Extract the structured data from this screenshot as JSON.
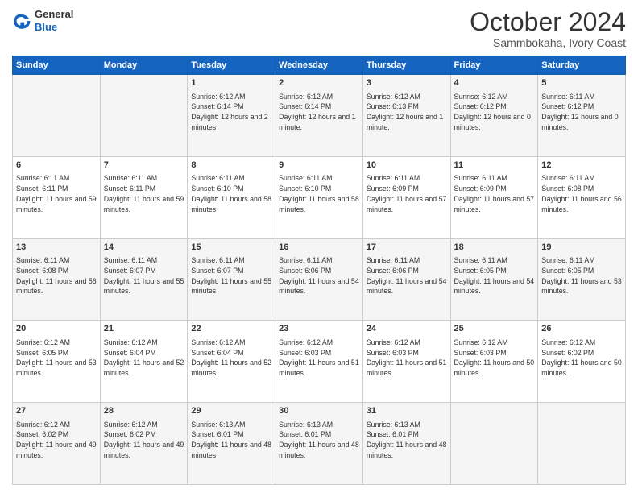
{
  "logo": {
    "general": "General",
    "blue": "Blue"
  },
  "header": {
    "month": "October 2024",
    "location": "Sammbokaha, Ivory Coast"
  },
  "weekdays": [
    "Sunday",
    "Monday",
    "Tuesday",
    "Wednesday",
    "Thursday",
    "Friday",
    "Saturday"
  ],
  "weeks": [
    [
      {
        "day": null
      },
      {
        "day": null
      },
      {
        "day": "1",
        "sunrise": "Sunrise: 6:12 AM",
        "sunset": "Sunset: 6:14 PM",
        "daylight": "Daylight: 12 hours and 2 minutes."
      },
      {
        "day": "2",
        "sunrise": "Sunrise: 6:12 AM",
        "sunset": "Sunset: 6:14 PM",
        "daylight": "Daylight: 12 hours and 1 minute."
      },
      {
        "day": "3",
        "sunrise": "Sunrise: 6:12 AM",
        "sunset": "Sunset: 6:13 PM",
        "daylight": "Daylight: 12 hours and 1 minute."
      },
      {
        "day": "4",
        "sunrise": "Sunrise: 6:12 AM",
        "sunset": "Sunset: 6:12 PM",
        "daylight": "Daylight: 12 hours and 0 minutes."
      },
      {
        "day": "5",
        "sunrise": "Sunrise: 6:11 AM",
        "sunset": "Sunset: 6:12 PM",
        "daylight": "Daylight: 12 hours and 0 minutes."
      }
    ],
    [
      {
        "day": "6",
        "sunrise": "Sunrise: 6:11 AM",
        "sunset": "Sunset: 6:11 PM",
        "daylight": "Daylight: 11 hours and 59 minutes."
      },
      {
        "day": "7",
        "sunrise": "Sunrise: 6:11 AM",
        "sunset": "Sunset: 6:11 PM",
        "daylight": "Daylight: 11 hours and 59 minutes."
      },
      {
        "day": "8",
        "sunrise": "Sunrise: 6:11 AM",
        "sunset": "Sunset: 6:10 PM",
        "daylight": "Daylight: 11 hours and 58 minutes."
      },
      {
        "day": "9",
        "sunrise": "Sunrise: 6:11 AM",
        "sunset": "Sunset: 6:10 PM",
        "daylight": "Daylight: 11 hours and 58 minutes."
      },
      {
        "day": "10",
        "sunrise": "Sunrise: 6:11 AM",
        "sunset": "Sunset: 6:09 PM",
        "daylight": "Daylight: 11 hours and 57 minutes."
      },
      {
        "day": "11",
        "sunrise": "Sunrise: 6:11 AM",
        "sunset": "Sunset: 6:09 PM",
        "daylight": "Daylight: 11 hours and 57 minutes."
      },
      {
        "day": "12",
        "sunrise": "Sunrise: 6:11 AM",
        "sunset": "Sunset: 6:08 PM",
        "daylight": "Daylight: 11 hours and 56 minutes."
      }
    ],
    [
      {
        "day": "13",
        "sunrise": "Sunrise: 6:11 AM",
        "sunset": "Sunset: 6:08 PM",
        "daylight": "Daylight: 11 hours and 56 minutes."
      },
      {
        "day": "14",
        "sunrise": "Sunrise: 6:11 AM",
        "sunset": "Sunset: 6:07 PM",
        "daylight": "Daylight: 11 hours and 55 minutes."
      },
      {
        "day": "15",
        "sunrise": "Sunrise: 6:11 AM",
        "sunset": "Sunset: 6:07 PM",
        "daylight": "Daylight: 11 hours and 55 minutes."
      },
      {
        "day": "16",
        "sunrise": "Sunrise: 6:11 AM",
        "sunset": "Sunset: 6:06 PM",
        "daylight": "Daylight: 11 hours and 54 minutes."
      },
      {
        "day": "17",
        "sunrise": "Sunrise: 6:11 AM",
        "sunset": "Sunset: 6:06 PM",
        "daylight": "Daylight: 11 hours and 54 minutes."
      },
      {
        "day": "18",
        "sunrise": "Sunrise: 6:11 AM",
        "sunset": "Sunset: 6:05 PM",
        "daylight": "Daylight: 11 hours and 54 minutes."
      },
      {
        "day": "19",
        "sunrise": "Sunrise: 6:11 AM",
        "sunset": "Sunset: 6:05 PM",
        "daylight": "Daylight: 11 hours and 53 minutes."
      }
    ],
    [
      {
        "day": "20",
        "sunrise": "Sunrise: 6:12 AM",
        "sunset": "Sunset: 6:05 PM",
        "daylight": "Daylight: 11 hours and 53 minutes."
      },
      {
        "day": "21",
        "sunrise": "Sunrise: 6:12 AM",
        "sunset": "Sunset: 6:04 PM",
        "daylight": "Daylight: 11 hours and 52 minutes."
      },
      {
        "day": "22",
        "sunrise": "Sunrise: 6:12 AM",
        "sunset": "Sunset: 6:04 PM",
        "daylight": "Daylight: 11 hours and 52 minutes."
      },
      {
        "day": "23",
        "sunrise": "Sunrise: 6:12 AM",
        "sunset": "Sunset: 6:03 PM",
        "daylight": "Daylight: 11 hours and 51 minutes."
      },
      {
        "day": "24",
        "sunrise": "Sunrise: 6:12 AM",
        "sunset": "Sunset: 6:03 PM",
        "daylight": "Daylight: 11 hours and 51 minutes."
      },
      {
        "day": "25",
        "sunrise": "Sunrise: 6:12 AM",
        "sunset": "Sunset: 6:03 PM",
        "daylight": "Daylight: 11 hours and 50 minutes."
      },
      {
        "day": "26",
        "sunrise": "Sunrise: 6:12 AM",
        "sunset": "Sunset: 6:02 PM",
        "daylight": "Daylight: 11 hours and 50 minutes."
      }
    ],
    [
      {
        "day": "27",
        "sunrise": "Sunrise: 6:12 AM",
        "sunset": "Sunset: 6:02 PM",
        "daylight": "Daylight: 11 hours and 49 minutes."
      },
      {
        "day": "28",
        "sunrise": "Sunrise: 6:12 AM",
        "sunset": "Sunset: 6:02 PM",
        "daylight": "Daylight: 11 hours and 49 minutes."
      },
      {
        "day": "29",
        "sunrise": "Sunrise: 6:13 AM",
        "sunset": "Sunset: 6:01 PM",
        "daylight": "Daylight: 11 hours and 48 minutes."
      },
      {
        "day": "30",
        "sunrise": "Sunrise: 6:13 AM",
        "sunset": "Sunset: 6:01 PM",
        "daylight": "Daylight: 11 hours and 48 minutes."
      },
      {
        "day": "31",
        "sunrise": "Sunrise: 6:13 AM",
        "sunset": "Sunset: 6:01 PM",
        "daylight": "Daylight: 11 hours and 48 minutes."
      },
      {
        "day": null
      },
      {
        "day": null
      }
    ]
  ]
}
